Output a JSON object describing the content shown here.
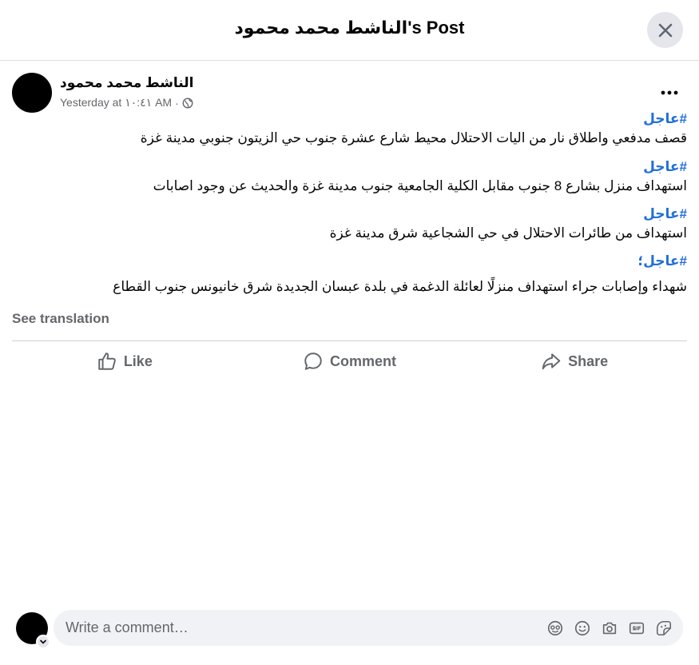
{
  "header": {
    "title": "الناشط محمد محمود's Post"
  },
  "post": {
    "author": "الناشط محمد محمود",
    "timestamp": "Yesterday at ١٠:٤١ AM",
    "audience_separator": "·",
    "paragraphs": [
      {
        "tag": "#عاجل",
        "text": "قصف مدفعي واطلاق نار من اليات الاحتلال محيط شارع عشرة جنوب حي الزيتون جنوبي مدينة غزة"
      },
      {
        "tag": "#عاجل",
        "text": "استهداف منزل بشارع 8 جنوب مقابل الكلية الجامعية جنوب مدينة غزة والحديث عن وجود اصابات"
      },
      {
        "tag": "#عاجل",
        "text": "استهداف من طائرات الاحتلال في حي الشجاعية شرق مدينة غزة"
      },
      {
        "tag": "#عاجل؛",
        "text": "شهداء وإصابات جراء استهداف منزلًا لعائلة الدغمة في بلدة عبسان الجديدة شرق خانيونس جنوب القطاع"
      }
    ],
    "see_translation": "See translation"
  },
  "actions": {
    "like": "Like",
    "comment": "Comment",
    "share": "Share"
  },
  "composer": {
    "placeholder": "Write a comment…"
  },
  "icons": {
    "close": "close-icon",
    "more": "more-dots-icon",
    "globe": "globe-icon",
    "like": "thumbs-up-icon",
    "comment": "speech-bubble-icon",
    "share": "share-arrow-icon",
    "avatar_sticker": "avatar-sticker-icon",
    "emoji": "emoji-icon",
    "camera": "camera-icon",
    "gif": "gif-icon",
    "sticker": "sticker-icon",
    "chevron": "chevron-down-icon"
  },
  "colors": {
    "hashtag": "#216fdb",
    "secondary_text": "#65676b",
    "surface": "#f0f2f5"
  }
}
